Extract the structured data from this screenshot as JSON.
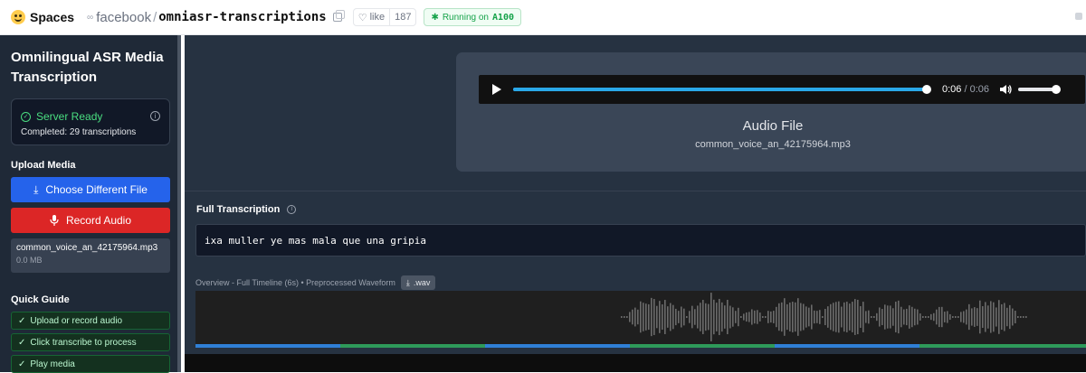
{
  "header": {
    "spaces_label": "Spaces",
    "owner": "facebook",
    "separator": "/",
    "repo": "omniasr-transcriptions",
    "like_label": "like",
    "like_count": "187",
    "running_prefix": "Running on",
    "running_hw": "A100"
  },
  "sidebar": {
    "title": "Omnilingual ASR Media Transcription",
    "status": {
      "label": "Server Ready",
      "sub": "Completed: 29 transcriptions"
    },
    "upload_heading": "Upload Media",
    "choose_button": "Choose Different File",
    "record_button": "Record Audio",
    "file": {
      "name": "common_voice_an_42175964.mp3",
      "size": "0.0 MB"
    },
    "guide_heading": "Quick Guide",
    "guide_items": [
      "Upload or record audio",
      "Click transcribe to process",
      "Play media"
    ]
  },
  "player": {
    "current": "0:06",
    "sep": "/",
    "duration": "0:06",
    "progress": 1.0,
    "volume": 0.85,
    "label": "Audio File",
    "filename": "common_voice_an_42175964.mp3"
  },
  "transcription": {
    "heading": "Full Transcription",
    "text": "ixa muller ye mas mala que una gripia"
  },
  "overview": {
    "label": "Overview - Full Timeline (6s) • Preprocessed Waveform",
    "download_label": ".wav"
  },
  "colors": {
    "accent_blue": "#2563eb",
    "record_red": "#dc2626",
    "ready_green": "#4ade80",
    "segment_blue": "#2f7fd6",
    "segment_green": "#2e9a5a"
  }
}
